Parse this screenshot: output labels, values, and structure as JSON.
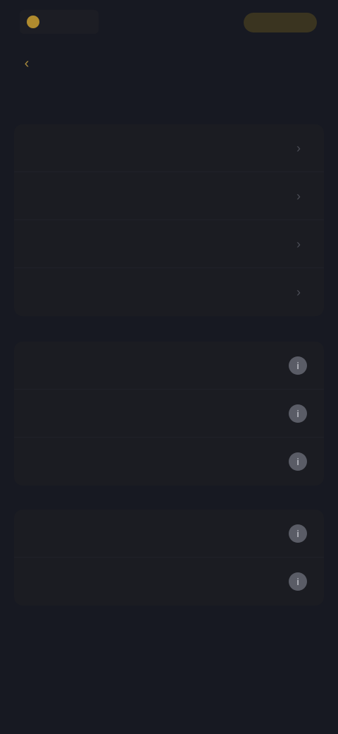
{
  "header": {
    "logo_text": "",
    "action_label": "",
    "back_icon": "chevron-left-icon"
  },
  "group1": {
    "items": [
      {
        "label": "",
        "icon": "chevron-right-icon"
      },
      {
        "label": "",
        "icon": "chevron-right-icon"
      },
      {
        "label": "",
        "icon": "chevron-right-icon"
      },
      {
        "label": "",
        "icon": "chevron-right-icon"
      }
    ]
  },
  "group2": {
    "items": [
      {
        "label": "",
        "icon": "info-icon"
      },
      {
        "label": "",
        "icon": "info-icon"
      },
      {
        "label": "",
        "icon": "info-icon"
      }
    ]
  },
  "group3": {
    "items": [
      {
        "label": "",
        "icon": "info-icon"
      },
      {
        "label": "",
        "icon": "info-icon"
      }
    ]
  },
  "footer": {
    "links": [
      "",
      "",
      ""
    ],
    "version": ""
  },
  "colors": {
    "background": "#171922",
    "accent": "#e3c16a"
  }
}
